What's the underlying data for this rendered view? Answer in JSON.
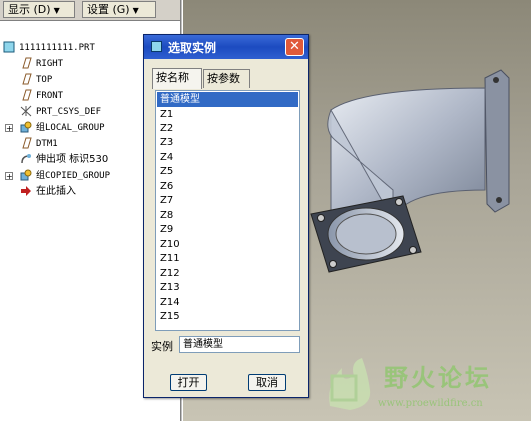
{
  "toolbar": {
    "display_label": "显示 (D)",
    "settings_label": "设置 (G)"
  },
  "tree": {
    "items": [
      {
        "label": "1111111111.PRT",
        "icon": "part-icon",
        "expandable": false
      },
      {
        "label": "RIGHT",
        "icon": "datum-plane-icon",
        "expandable": false
      },
      {
        "label": "TOP",
        "icon": "datum-plane-icon",
        "expandable": false
      },
      {
        "label": "FRONT",
        "icon": "datum-plane-icon",
        "expandable": false
      },
      {
        "label": "PRT_CSYS_DEF",
        "icon": "coordinate-system-icon",
        "expandable": false
      },
      {
        "label": "组LOCAL_GROUP",
        "icon": "group-icon",
        "expandable": true
      },
      {
        "label": "DTM1",
        "icon": "datum-plane-icon",
        "expandable": false
      },
      {
        "label": "伸出项 标识530",
        "icon": "protrusion-icon",
        "expandable": false
      },
      {
        "label": "组COPIED_GROUP",
        "icon": "group-icon",
        "expandable": true
      },
      {
        "label": "在此插入",
        "icon": "insert-here-arrow-icon",
        "expandable": false
      }
    ]
  },
  "dialog": {
    "title": "选取实例",
    "tabs": [
      {
        "label": "按名称",
        "active": true
      },
      {
        "label": "按参数",
        "active": false
      }
    ],
    "list": [
      "普通模型",
      "Z1",
      "Z2",
      "Z3",
      "Z4",
      "Z5",
      "Z6",
      "Z7",
      "Z8",
      "Z9",
      "Z10",
      "Z11",
      "Z12",
      "Z13",
      "Z14",
      "Z15"
    ],
    "selected_index": 0,
    "instance_label": "实例",
    "instance_value": "普通模型",
    "open_label": "打开",
    "cancel_label": "取消"
  },
  "watermark": {
    "title": "野火论坛",
    "url": "www.proewildfire.cn"
  },
  "colors": {
    "titlebar": "#1c4bc0",
    "selection": "#316ac5",
    "viewport_bg": "#a8a496"
  }
}
